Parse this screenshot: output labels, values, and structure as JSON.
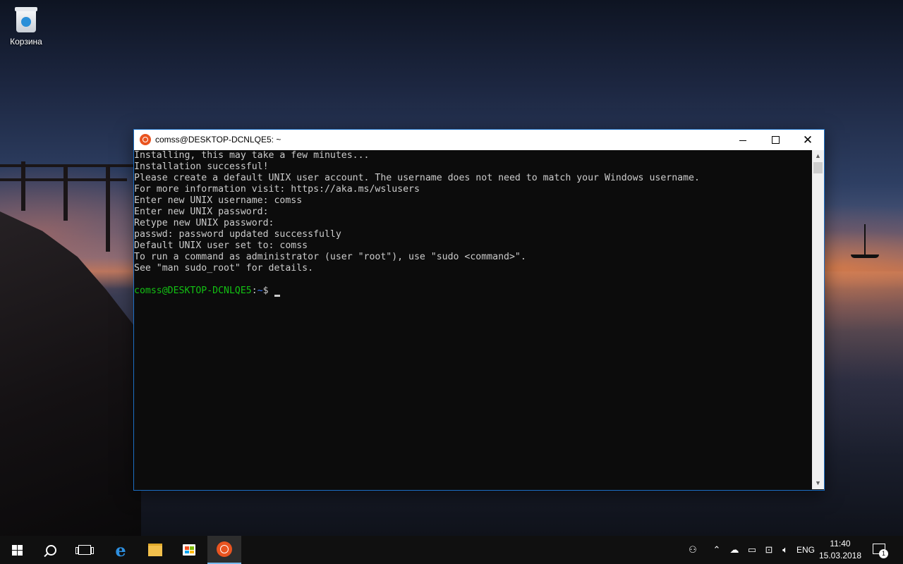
{
  "desktop": {
    "recycle_bin_label": "Корзина"
  },
  "window": {
    "title": "comss@DESKTOP-DCNLQE5: ~",
    "minimize_icon": "minimize-icon",
    "maximize_icon": "maximize-icon",
    "close_glyph": "✕"
  },
  "terminal": {
    "lines": [
      "Installing, this may take a few minutes...",
      "Installation successful!",
      "Please create a default UNIX user account. The username does not need to match your Windows username.",
      "For more information visit: https://aka.ms/wslusers",
      "Enter new UNIX username: comss",
      "Enter new UNIX password:",
      "Retype new UNIX password:",
      "passwd: password updated successfully",
      "Default UNIX user set to: comss",
      "To run a command as administrator (user \"root\"), use \"sudo <command>\".",
      "See \"man sudo_root\" for details."
    ],
    "prompt_user": "comss@DESKTOP-DCNLQE5",
    "prompt_sep": ":",
    "prompt_path": "~",
    "prompt_symbol": "$"
  },
  "taskbar": {
    "language": "ENG",
    "time": "11:40",
    "date": "15.03.2018",
    "notification_count": "1",
    "colors": {
      "accent": "#76b9ed",
      "ubuntu": "#e95420",
      "prompt_user": "#13c113",
      "prompt_path": "#3b78ff"
    }
  }
}
